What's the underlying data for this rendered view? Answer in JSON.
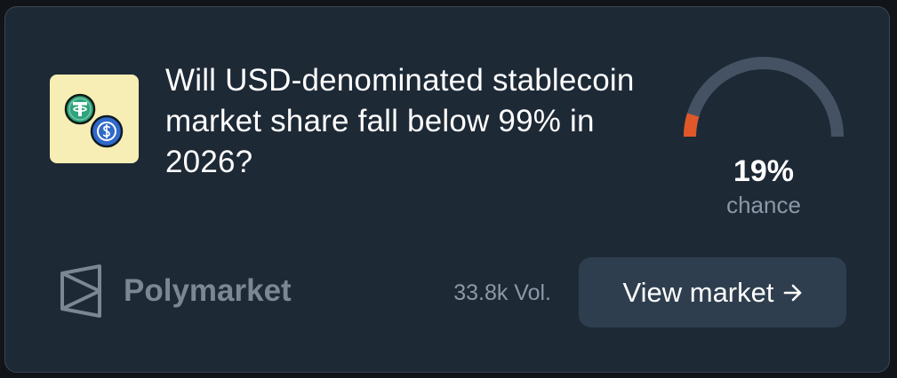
{
  "market": {
    "question": "Will USD-denominated stablecoin market share fall below 99% in 2026?",
    "icon": "stablecoin-coins-icon"
  },
  "gauge": {
    "value_text": "19%",
    "percent": 19,
    "caption": "chance",
    "fill_color": "#e0582a",
    "track_color": "#445263"
  },
  "footer": {
    "brand": "Polymarket",
    "brand_icon": "polymarket-logo-icon",
    "volume": "33.8k Vol.",
    "button_label": "View market",
    "button_icon": "arrow-right-icon"
  },
  "colors": {
    "background": "#111418",
    "card": "#1e2936",
    "button": "#2f3e4e",
    "accent": "#e0582a"
  }
}
